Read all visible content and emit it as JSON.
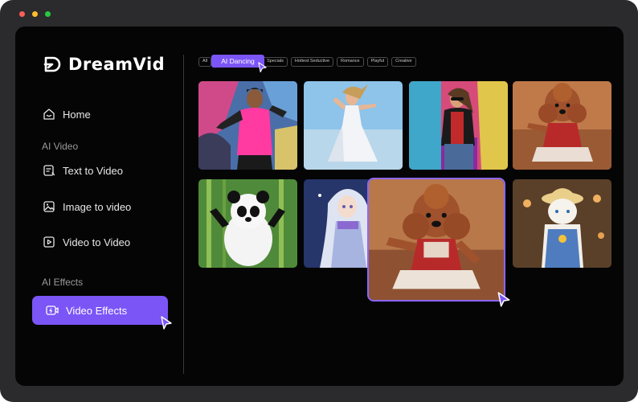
{
  "app": {
    "name": "DreamVid"
  },
  "sidebar": {
    "home_label": "Home",
    "section_ai_video": "AI Video",
    "text_to_video": "Text to Video",
    "image_to_video": "Image to video",
    "video_to_video": "Video to Video",
    "section_ai_effects": "AI Effects",
    "video_effects": "Video Effects"
  },
  "filters": {
    "all": "All",
    "active": "AI Dancing",
    "specials": "Specials",
    "hottest": "Hottest Seductive",
    "romance": "Romance",
    "playful": "Playful",
    "creative": "Creative"
  },
  "colors": {
    "accent": "#7b55f6",
    "background": "#050505",
    "frame": "#2b2b2d"
  },
  "thumbnails": [
    {
      "name": "dancer-pink-jersey"
    },
    {
      "name": "woman-white-dress-beach"
    },
    {
      "name": "woman-leather-jacket-graffiti"
    },
    {
      "name": "poodle-in-dress"
    },
    {
      "name": "panda-bamboo"
    },
    {
      "name": "anime-girl-silver-hair"
    },
    {
      "name": "poodle-in-dress-enlarged"
    },
    {
      "name": "cat-overalls-straw-hat"
    }
  ]
}
